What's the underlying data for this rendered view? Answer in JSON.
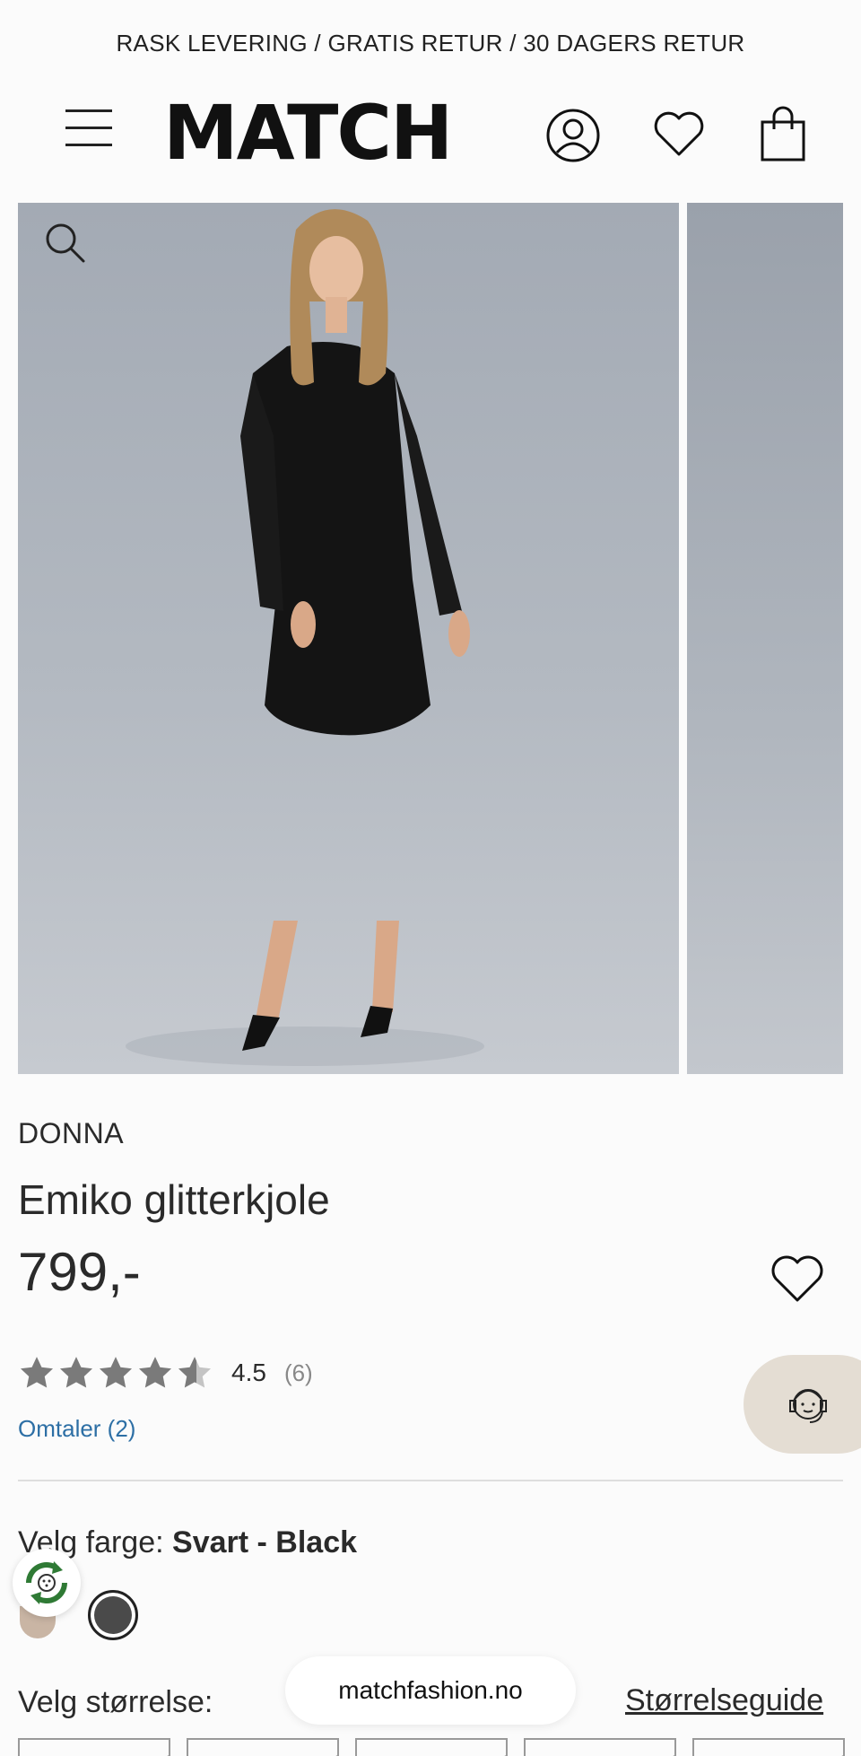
{
  "promo": {
    "text": "RASK LEVERING / GRATIS RETUR / 30 DAGERS RETUR"
  },
  "header": {
    "logo": "MATCH",
    "icons": [
      "menu-icon",
      "account-icon",
      "heart-icon",
      "shopping-bag-icon"
    ]
  },
  "gallery": {
    "images": 2,
    "zoom_icon": "search-icon"
  },
  "product": {
    "brand": "DONNA",
    "title": "Emiko glitterkjole",
    "price": "799,-",
    "wishlist_icon": "heart-icon"
  },
  "rating": {
    "value": "4.5",
    "stars_filled_fraction": 0.9,
    "count": "(6)",
    "reviews_link": "Omtaler (2)"
  },
  "color": {
    "label": "Velg farge:",
    "selected": "Svart - Black",
    "swatches": [
      "#c9b5a4",
      "#4a4a4a"
    ]
  },
  "size": {
    "label": "Velg størrelse:",
    "guide_link": "Størrelseguide"
  },
  "browser": {
    "url": "matchfashion.no"
  },
  "colors": {
    "text": "#2a2a2a",
    "link": "#2d6fa5",
    "star": "#7a7a7a",
    "support_bg": "#e4ddd3"
  }
}
